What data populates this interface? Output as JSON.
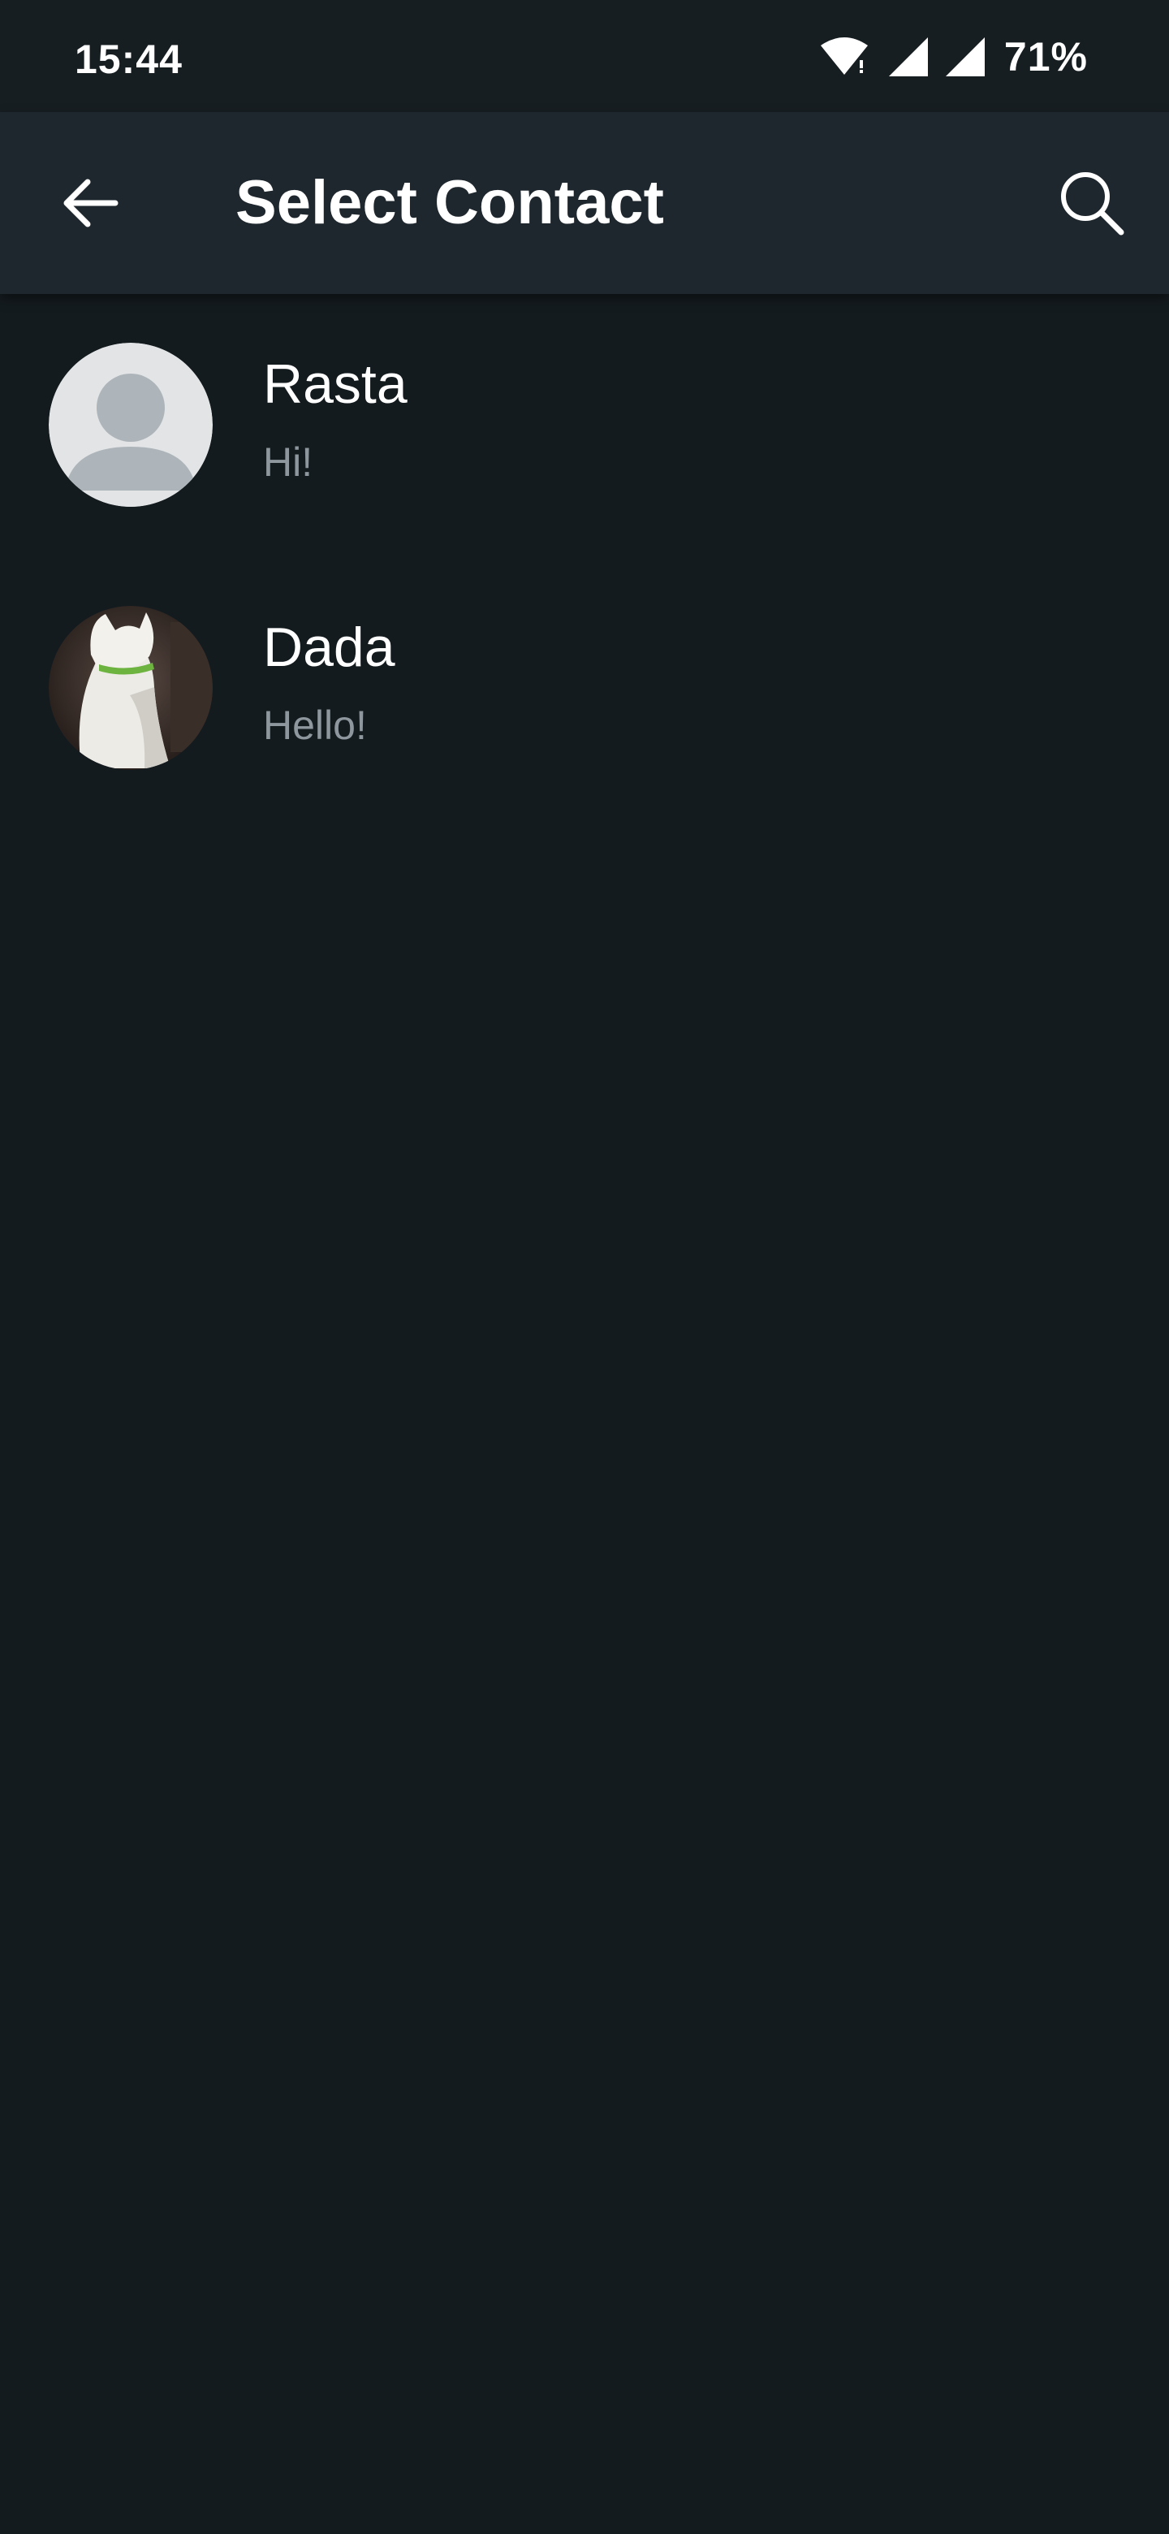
{
  "status_bar": {
    "time": "15:44",
    "battery": "71%",
    "icons": [
      "wifi-icon",
      "signal-icon",
      "signal-icon"
    ]
  },
  "app_bar": {
    "back_icon": "arrow-back-icon",
    "title": "Select Contact",
    "search_icon": "search-icon"
  },
  "contacts": [
    {
      "name": "Rasta",
      "status": "Hi!",
      "avatar": "default-avatar-icon"
    },
    {
      "name": "Dada",
      "status": "Hello!",
      "avatar": "cat-photo"
    }
  ],
  "colors": {
    "background": "#141b1f",
    "app_bar": "#1f272e",
    "status_bar": "#171e22",
    "primary_text": "#ffffff",
    "secondary_text": "#8d979d"
  }
}
